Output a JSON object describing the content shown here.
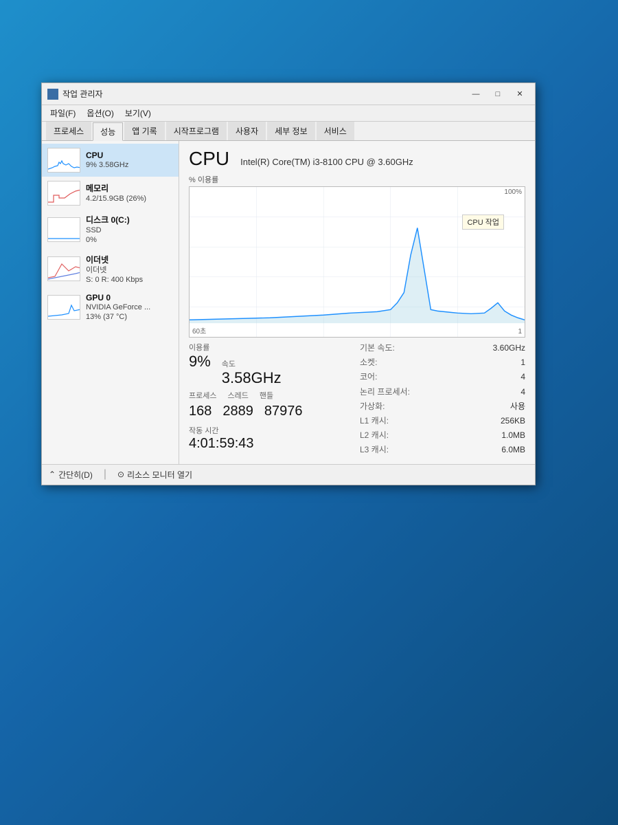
{
  "window": {
    "title": "작업 관리자",
    "title_icon": "taskmgr"
  },
  "menu": {
    "items": [
      "파일(F)",
      "옵션(O)",
      "보기(V)"
    ]
  },
  "tabs": [
    {
      "label": "프로세스",
      "active": false
    },
    {
      "label": "성능",
      "active": true
    },
    {
      "label": "앱 기록",
      "active": false
    },
    {
      "label": "시작프로그램",
      "active": false
    },
    {
      "label": "사용자",
      "active": false
    },
    {
      "label": "세부 정보",
      "active": false
    },
    {
      "label": "서비스",
      "active": false
    }
  ],
  "sidebar": {
    "items": [
      {
        "id": "cpu",
        "title": "CPU",
        "sub1": "9% 3.58GHz",
        "active": true
      },
      {
        "id": "memory",
        "title": "메모리",
        "sub1": "4.2/15.9GB (26%)",
        "active": false
      },
      {
        "id": "disk",
        "title": "디스크 0(C:)",
        "sub1": "SSD",
        "sub2": "0%",
        "active": false
      },
      {
        "id": "ethernet",
        "title": "이더넷",
        "sub1": "이더넷",
        "sub2": "S: 0 R: 400 Kbps",
        "active": false
      },
      {
        "id": "gpu",
        "title": "GPU 0",
        "sub1": "NVIDIA GeForce ...",
        "sub2": "13% (37 °C)",
        "active": false
      }
    ]
  },
  "cpu_panel": {
    "title": "CPU",
    "model": "Intel(R) Core(TM) i3-8100 CPU @ 3.60GHz",
    "graph_ylabel": "% 이용률",
    "graph_y_max": "100%",
    "graph_x_min": "60초",
    "graph_x_max": "1",
    "tooltip_text": "CPU 작업",
    "stats": {
      "usage_label": "이용률",
      "usage_value": "9%",
      "speed_label": "속도",
      "speed_value": "3.58GHz",
      "processes_label": "프로세스",
      "processes_value": "168",
      "threads_label": "스레드",
      "threads_value": "2889",
      "handles_label": "핸들",
      "handles_value": "87976",
      "uptime_label": "작동 시간",
      "uptime_value": "4:01:59:43"
    },
    "details": {
      "base_speed_label": "기본 속도:",
      "base_speed_value": "3.60GHz",
      "sockets_label": "소켓:",
      "sockets_value": "1",
      "cores_label": "코어:",
      "cores_value": "4",
      "logical_label": "논리 프로세서:",
      "logical_value": "4",
      "virtualization_label": "가상화:",
      "virtualization_value": "사용",
      "l1_label": "L1 캐시:",
      "l1_value": "256KB",
      "l2_label": "L2 캐시:",
      "l2_value": "1.0MB",
      "l3_label": "L3 캐시:",
      "l3_value": "6.0MB"
    }
  },
  "bottom_bar": {
    "simplify_label": "간단히(D)",
    "resource_monitor_label": "리소스 모니터 열기"
  },
  "title_controls": {
    "minimize": "—",
    "maximize": "□",
    "close": "✕"
  }
}
